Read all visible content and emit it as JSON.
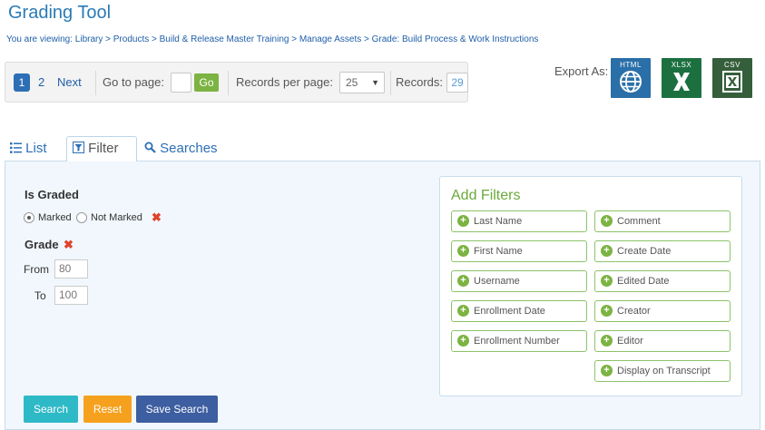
{
  "header": {
    "title": "Grading Tool",
    "breadcrumb": "You are viewing: Library > Products > Build & Release Master Training > Manage Assets > Grade: Build Process & Work Instructions"
  },
  "pager": {
    "current_page": "1",
    "page_2": "2",
    "next": "Next",
    "goto_label": "Go to page:",
    "goto_value": "",
    "go": "Go",
    "rpp_label": "Records per page:",
    "rpp_value": "25",
    "records_label": "Records:",
    "records_value": "29"
  },
  "export": {
    "label": "Export As:",
    "formats": [
      {
        "label": "HTML",
        "icon": "globe-icon",
        "color": "#2a6fa8"
      },
      {
        "label": "XLSX",
        "icon": "excel-x-icon",
        "color": "#1c7040"
      },
      {
        "label": "CSV",
        "icon": "csv-sheet-icon",
        "color": "#355e3b"
      }
    ]
  },
  "tabs": [
    {
      "label": "List",
      "icon": "list-icon"
    },
    {
      "label": "Filter",
      "icon": "filter-icon",
      "active": true
    },
    {
      "label": "Searches",
      "icon": "search-icon"
    }
  ],
  "filter": {
    "is_graded": {
      "label": "Is Graded",
      "options": [
        "Marked",
        "Not Marked"
      ],
      "selected": "Marked"
    },
    "grade": {
      "label": "Grade",
      "from_label": "From",
      "from_value": "80",
      "to_label": "To",
      "to_value": "100"
    }
  },
  "add_filters": {
    "title": "Add Filters",
    "left": [
      "Last Name",
      "First Name",
      "Username",
      "Enrollment Date",
      "Enrollment Number"
    ],
    "right": [
      "Comment",
      "Create Date",
      "Edited Date",
      "Creator",
      "Editor",
      "Display on Transcript"
    ]
  },
  "actions": {
    "search": "Search",
    "reset": "Reset",
    "save_search": "Save Search"
  },
  "colors": {
    "accent": "#2d6fb5",
    "green": "#7cb342",
    "search_btn": "#2eb9c7",
    "reset_btn": "#f6a11e",
    "save_btn": "#3d5ea0"
  }
}
